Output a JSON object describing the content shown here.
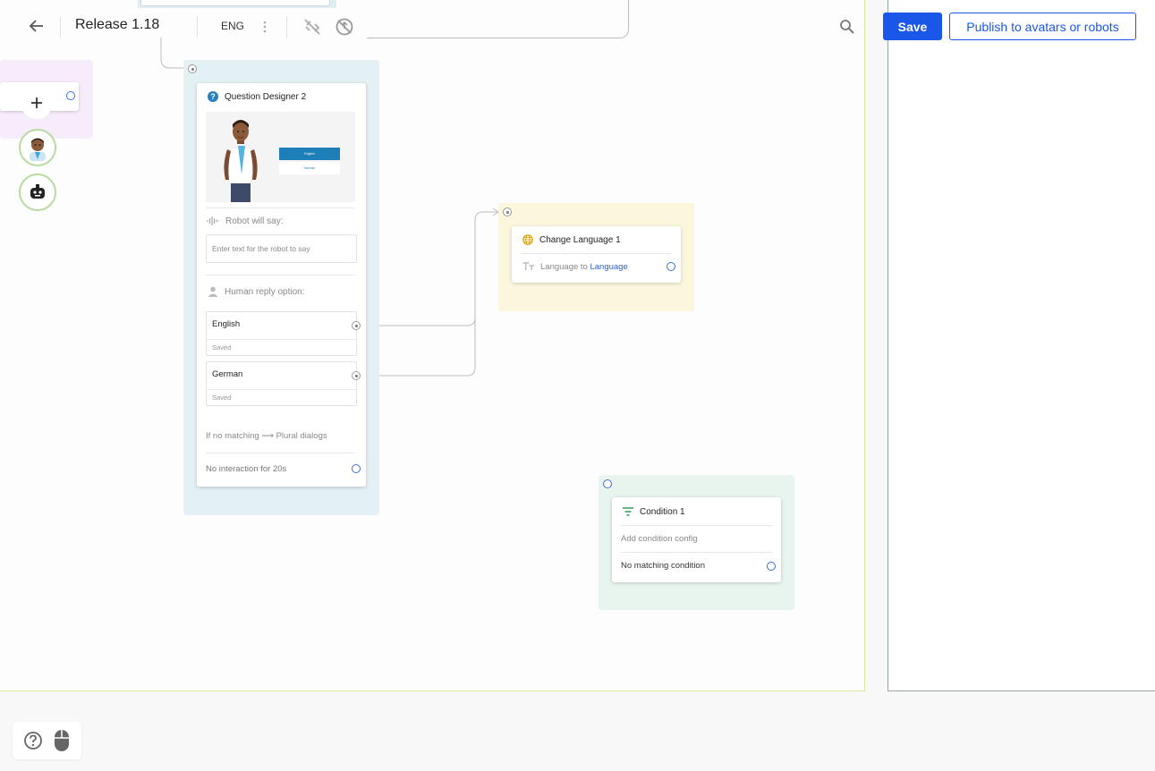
{
  "toolbar": {
    "title": "Release 1.18",
    "language": "ENG",
    "save_label": "Save",
    "publish_label": "Publish to avatars or robots"
  },
  "question_node": {
    "title": "Question Designer 2",
    "preview_button_1": "English",
    "preview_button_2": "German",
    "robot_say_label": "Robot will say:",
    "robot_say_placeholder": "Enter text for the robot to say",
    "human_reply_label": "Human reply option:",
    "replies": [
      {
        "label": "English",
        "status": "Saved"
      },
      {
        "label": "German",
        "status": "Saved"
      }
    ],
    "no_match_prefix": "If no matching",
    "no_match_arrow": "⟶",
    "no_match_target": "Plural dialogs",
    "no_interaction": "No interaction for 20s"
  },
  "change_language_node": {
    "title": "Change Language 1",
    "field_prefix": "Language to",
    "field_value": "Language"
  },
  "condition_node": {
    "title": "Condition 1",
    "config_placeholder": "Add condition config",
    "no_match": "No matching condition"
  },
  "colors": {
    "accent": "#1a56e8",
    "question_group": "#e3f0f4",
    "language_group": "#fbf6dc",
    "condition_group": "#e8f4ee",
    "start_group": "#f7ecfb"
  },
  "icons": [
    "back-arrow-icon",
    "more-vertical-icon",
    "link-off-icon",
    "no-sync-icon",
    "search-icon",
    "plus-icon",
    "avatar-icon",
    "robot-icon",
    "question-icon",
    "soundwave-icon",
    "person-icon",
    "globe-icon",
    "text-size-icon",
    "filter-icon",
    "help-icon",
    "mouse-icon"
  ]
}
